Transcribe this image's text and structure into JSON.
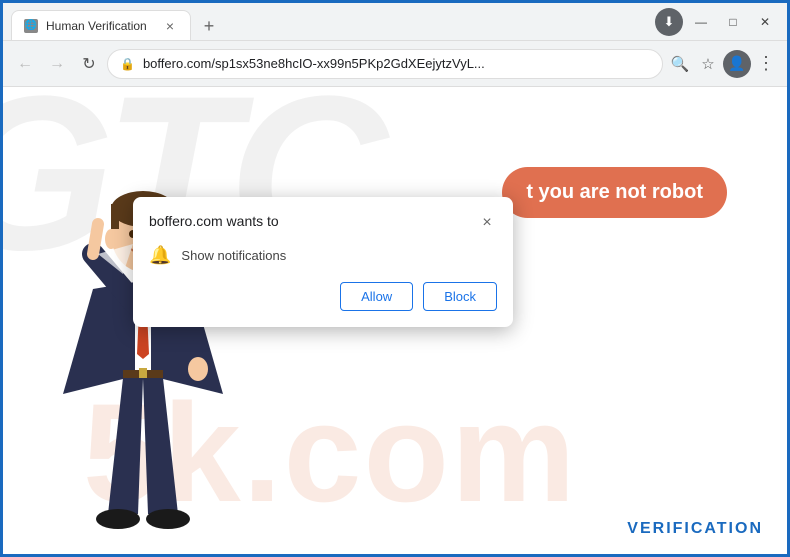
{
  "browser": {
    "tab": {
      "title": "Human Verification",
      "close_label": "×"
    },
    "new_tab_label": "+",
    "window_controls": {
      "minimize": "—",
      "maximize": "□",
      "close": "✕"
    },
    "address_bar": {
      "url": "boffero.com/sp1sx53ne8hcIO-xx99n5PKp2GdXEejytzVyL...",
      "lock_icon": "🔒"
    }
  },
  "dialog": {
    "title": "boffero.com wants to",
    "close_label": "×",
    "permission": "Show notifications",
    "allow_label": "Allow",
    "block_label": "Block"
  },
  "page": {
    "robot_text": "t you are not robot",
    "watermark_gtc": "GTC",
    "watermark_sk": "5k.com",
    "verification_label": "VERIFICATION"
  }
}
